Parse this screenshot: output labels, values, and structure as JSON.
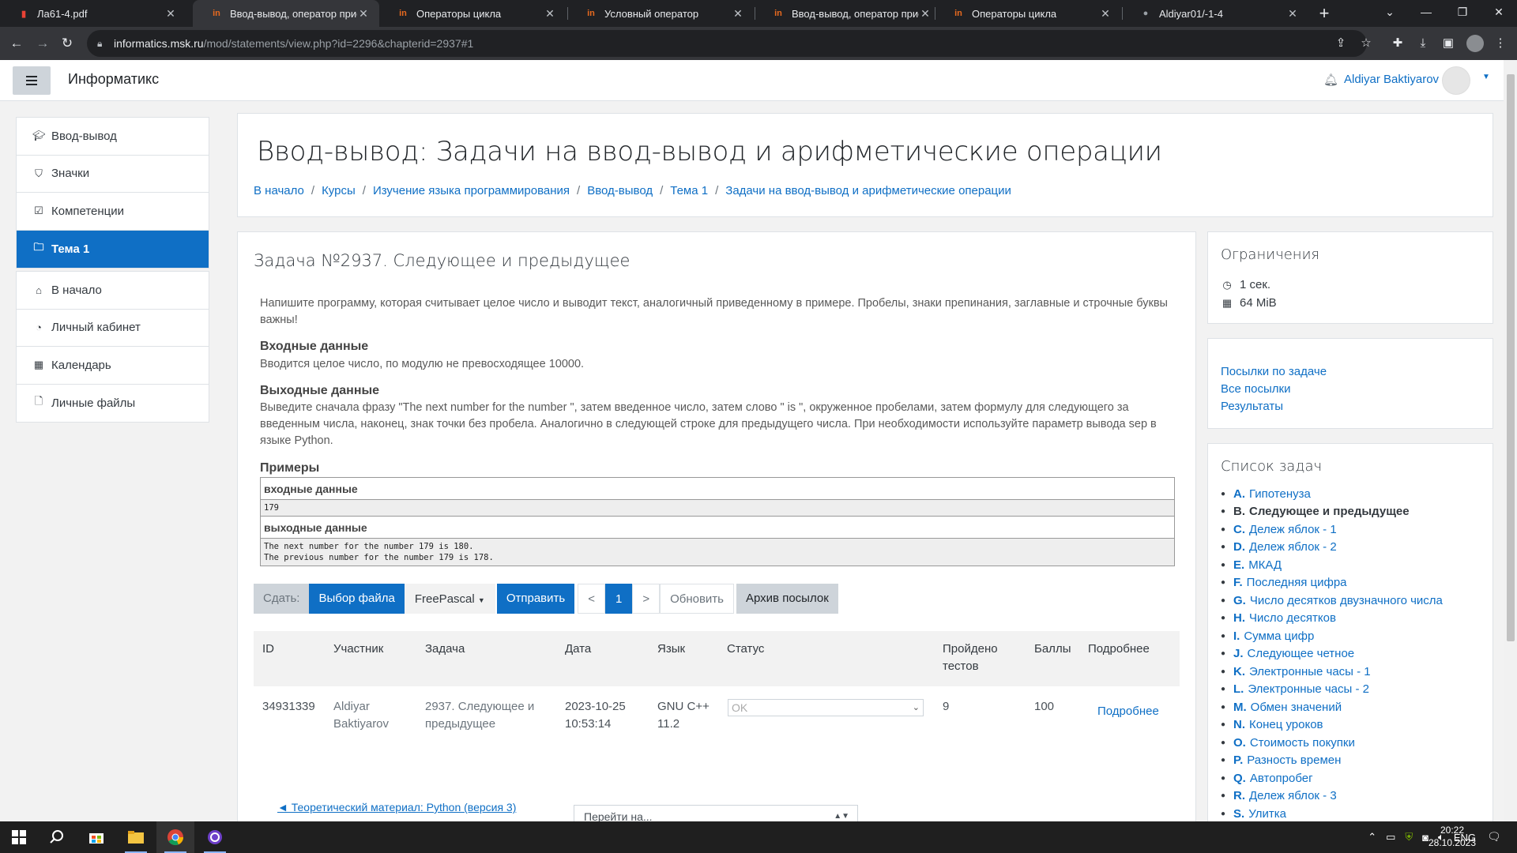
{
  "browser": {
    "tabs": [
      {
        "title": "Ла61-4.pdf",
        "icon": "pdf-icon",
        "active": false
      },
      {
        "title": "Ввод-вывод, оператор присва",
        "icon": "informatics-icon",
        "active": true
      },
      {
        "title": "Операторы цикла",
        "icon": "informatics-icon",
        "active": false
      },
      {
        "title": "Условный оператор",
        "icon": "informatics-icon",
        "active": false
      },
      {
        "title": "Ввод-вывод, оператор присва",
        "icon": "informatics-icon",
        "active": false
      },
      {
        "title": "Операторы цикла",
        "icon": "informatics-icon",
        "active": false
      },
      {
        "title": "Aldiyar01/-1-4",
        "icon": "github-icon",
        "active": false
      }
    ],
    "url_host": "informatics.msk.ru",
    "url_path": "/mod/statements/view.php?id=2296&chapterid=2937#1"
  },
  "navbar": {
    "site_name": "Информатикс",
    "user_name": "Aldiyar Baktiyarov"
  },
  "drawer": {
    "group1": [
      {
        "label": "Ввод-вывод",
        "icon": "graduation-cap-icon"
      },
      {
        "label": "Значки",
        "icon": "shield-icon"
      },
      {
        "label": "Компетенции",
        "icon": "checkbox-icon"
      },
      {
        "label": "Тема 1",
        "icon": "folder-icon",
        "active": true
      }
    ],
    "group2": [
      {
        "label": "В начало",
        "icon": "home-icon"
      },
      {
        "label": "Личный кабинет",
        "icon": "dashboard-icon"
      },
      {
        "label": "Календарь",
        "icon": "calendar-icon"
      },
      {
        "label": "Личные файлы",
        "icon": "file-icon"
      }
    ]
  },
  "header": {
    "title": "Ввод-вывод: Задачи на ввод-вывод и арифметические операции",
    "breadcrumb": [
      "В начало",
      "Курсы",
      "Изучение языка программирования",
      "Ввод-вывод",
      "Тема 1",
      "Задачи на ввод-вывод и арифметические операции"
    ]
  },
  "problem": {
    "title": "Задача №2937. Следующее и предыдущее",
    "statement": "Напишите программу, которая считывает целое число и выводит текст, аналогичный приведенному в примере. Пробелы, знаки препинания, заглавные и строчные буквы важны!",
    "input_heading": "Входные данные",
    "input_text": "Вводится целое число, по модулю не превосходящее 10000.",
    "output_heading": "Выходные данные",
    "output_text": "Выведите сначала фразу \"The next number for the number \", затем введенное число, затем слово \" is \", окруженное пробелами, затем формулу для следующего за введенным числа, наконец, знак точки без пробела. Аналогично в следующей строке для предыдущего числа. При необходимости используйте параметр вывода sep в языке Python.",
    "examples_heading": "Примеры",
    "example_input_label": "входные данные",
    "example_input": "179",
    "example_output_label": "выходные данные",
    "example_output": "The next number for the number 179 is 180.\nThe previous number for the number 179 is 178."
  },
  "submit": {
    "label": "Сдать:",
    "choose_file": "Выбор файла",
    "language": "FreePascal",
    "send": "Отправить",
    "prev": "<",
    "page": "1",
    "next": ">",
    "refresh": "Обновить",
    "archive": "Архив посылок"
  },
  "runs": {
    "headers": [
      "ID",
      "Участник",
      "Задача",
      "Дата",
      "Язык",
      "Статус",
      "Пройдено тестов",
      "Баллы",
      "Подробнее"
    ],
    "row": {
      "id": "34931339",
      "participant": "Aldiyar Baktiyarov",
      "problem": "2937. Следующее и предыдущее",
      "date": "2023-10-25 10:53:14",
      "language": "GNU C++ 11.2",
      "status": "OK",
      "tests": "9",
      "score": "100",
      "details": "Подробнее"
    }
  },
  "footer": {
    "prev_link": "◄ Теоретический материал: Python (версия 3)",
    "goto": "Перейти на..."
  },
  "limits": {
    "title": "Ограничения",
    "time": "1 сек.",
    "memory": "64 MiB"
  },
  "links": [
    "Посылки по задаче",
    "Все посылки",
    "Результаты"
  ],
  "tasks": {
    "title": "Список задач",
    "items": [
      {
        "letter": "A.",
        "name": "Гипотенуза"
      },
      {
        "letter": "B.",
        "name": "Следующее и предыдущее",
        "current": true
      },
      {
        "letter": "C.",
        "name": "Дележ яблок - 1"
      },
      {
        "letter": "D.",
        "name": "Дележ яблок - 2"
      },
      {
        "letter": "E.",
        "name": "МКАД"
      },
      {
        "letter": "F.",
        "name": "Последняя цифра"
      },
      {
        "letter": "G.",
        "name": "Число десятков двузначного числа"
      },
      {
        "letter": "H.",
        "name": "Число десятков"
      },
      {
        "letter": "I.",
        "name": "Сумма цифр"
      },
      {
        "letter": "J.",
        "name": "Следующее четное"
      },
      {
        "letter": "K.",
        "name": "Электронные часы - 1"
      },
      {
        "letter": "L.",
        "name": "Электронные часы - 2"
      },
      {
        "letter": "M.",
        "name": "Обмен значений"
      },
      {
        "letter": "N.",
        "name": "Конец уроков"
      },
      {
        "letter": "O.",
        "name": "Стоимость покупки"
      },
      {
        "letter": "P.",
        "name": "Разность времен"
      },
      {
        "letter": "Q.",
        "name": "Автопробег"
      },
      {
        "letter": "R.",
        "name": "Дележ яблок - 3"
      },
      {
        "letter": "S.",
        "name": "Улитка"
      }
    ]
  },
  "taskbar": {
    "lang": "ENG",
    "time": "20:22",
    "date": "28.10.2023"
  },
  "colors": {
    "accent": "#0f6fc5",
    "chrome_dark": "#202124",
    "chrome_toolbar": "#35363a"
  }
}
